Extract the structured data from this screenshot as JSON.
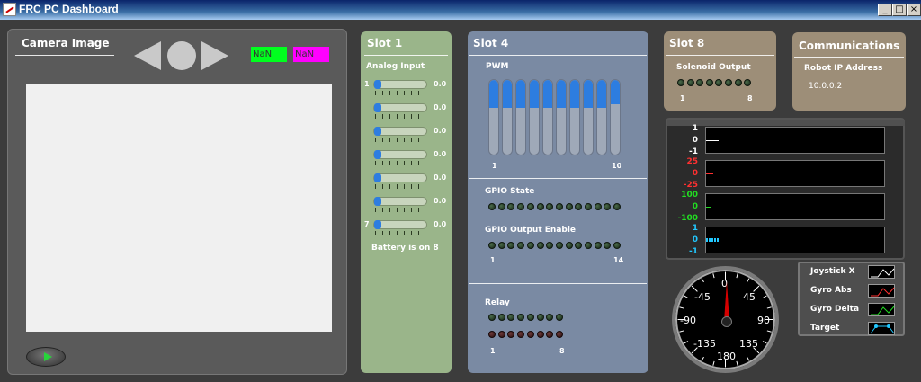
{
  "window": {
    "title": "FRC PC Dashboard",
    "buttons": [
      "_",
      "□",
      "×"
    ]
  },
  "camera": {
    "title": "Camera Image",
    "readout_green": "NaN",
    "readout_magenta": "NaN",
    "colors": {
      "green": "#00ff1e",
      "magenta": "#ff00ff"
    },
    "icons": [
      "left-arrow-icon",
      "circle-icon",
      "right-arrow-icon",
      "play-icon"
    ]
  },
  "slot1": {
    "title": "Slot 1",
    "analog_label": "Analog Input",
    "first_index": "1",
    "last_index": "7",
    "values": [
      "0.0",
      "0.0",
      "0.0",
      "0.0",
      "0.0",
      "0.0",
      "0.0"
    ],
    "battery": "Battery is on 8"
  },
  "slot4": {
    "title": "Slot 4",
    "pwm_label": "PWM",
    "pwm_first": "1",
    "pwm_last": "10",
    "pwm_levels": [
      0.37,
      0.37,
      0.37,
      0.37,
      0.37,
      0.37,
      0.37,
      0.37,
      0.37,
      0.33
    ],
    "gpio_state_label": "GPIO State",
    "gpio_output_label": "GPIO Output Enable",
    "gpio_first": "1",
    "gpio_last": "14",
    "relay_label": "Relay",
    "relay_first": "1",
    "relay_last": "8"
  },
  "slot8": {
    "title": "Slot 8",
    "solenoid_label": "Solenoid Output",
    "first": "1",
    "last": "8"
  },
  "communications": {
    "title": "Communications",
    "ip_label": "Robot IP Address",
    "ip_value": "10.0.0.2"
  },
  "strip_charts": {
    "chart1": {
      "top": "1",
      "mid": "0",
      "bottom": "-1",
      "color": "#ffffff"
    },
    "chart2": {
      "top": "25",
      "mid": "0",
      "bottom": "-25",
      "color": "#ff3030"
    },
    "chart3": {
      "top": "100",
      "mid": "0",
      "bottom": "-100",
      "color": "#22dd22"
    },
    "chart4": {
      "top": "1",
      "mid": "0",
      "bottom": "-1",
      "color": "#22c8ff"
    }
  },
  "gauge": {
    "labels": {
      "n0": "0",
      "n45": "45",
      "nm45": "-45",
      "n90": "90",
      "nm90": "-90",
      "n135": "135",
      "nm135": "-135",
      "n180": "180"
    },
    "value": 0
  },
  "legend": {
    "items": [
      "Joystick X",
      "Gyro Abs",
      "Gyro Delta",
      "Target"
    ],
    "colors": [
      "#ffffff",
      "#ff3030",
      "#22dd22",
      "#22c8ff"
    ]
  }
}
